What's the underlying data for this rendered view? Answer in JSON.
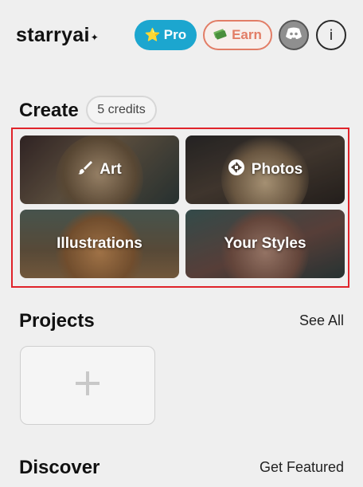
{
  "header": {
    "logo_text": "starryai",
    "logo_mark": "✦",
    "pro_label": "Pro",
    "pro_icon": "star-icon",
    "earn_label": "Earn",
    "earn_icon": "money-icon",
    "discord_icon": "discord-icon",
    "info_label": "i"
  },
  "create": {
    "title": "Create",
    "credits": "5 credits",
    "tiles": [
      {
        "label": "Art",
        "icon": "brush-icon"
      },
      {
        "label": "Photos",
        "icon": "camera-aperture-icon"
      },
      {
        "label": "Illustrations",
        "icon": ""
      },
      {
        "label": "Your Styles",
        "icon": ""
      }
    ]
  },
  "projects": {
    "title": "Projects",
    "see_all": "See All",
    "add_icon": "plus-icon"
  },
  "discover": {
    "title": "Discover",
    "get_featured": "Get Featured"
  },
  "colors": {
    "pro_bg": "#1ca6cf",
    "earn_accent": "#e27d66",
    "highlight_border": "#e0232a",
    "page_bg": "#efefef"
  }
}
